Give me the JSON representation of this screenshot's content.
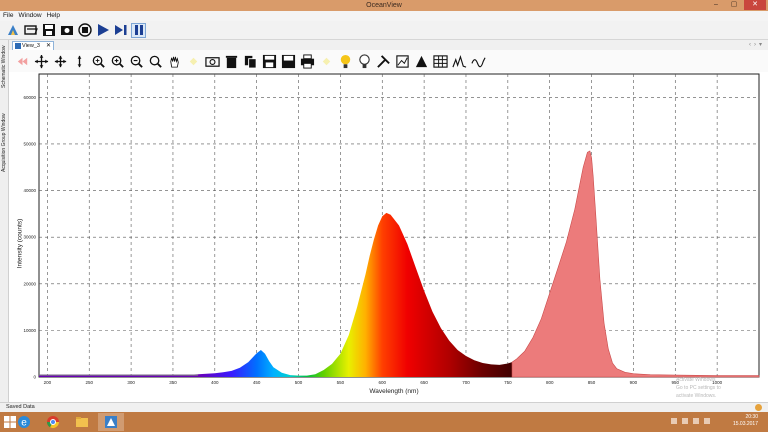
{
  "window": {
    "title": "OceanView",
    "minimize": "–",
    "maximize": "▢",
    "close": "✕"
  },
  "menu": [
    "File",
    "Window",
    "Help"
  ],
  "sidebar": {
    "tabs": [
      "Schematic Window",
      "Acquisition Group Window"
    ]
  },
  "view_tab": {
    "label": "View_3",
    "close": "✕"
  },
  "tab_nav": {
    "prev": "‹",
    "next": "›",
    "menu": "▾"
  },
  "main_toolbar": [
    "app-logo-icon",
    "open-icon",
    "save-icon",
    "camera-capture-icon",
    "device-icon",
    "play-icon",
    "step-icon",
    "pause-icon"
  ],
  "graph_toolbar": [
    "undo-icon",
    "move-icon",
    "move-xy-icon",
    "move-y-icon",
    "zoom-fit-icon",
    "zoom-in-icon",
    "zoom-out-icon",
    "zoom-reset-icon",
    "hand-icon",
    "spacer",
    "camera-icon",
    "trash-icon",
    "copy-icon",
    "save-graph-icon",
    "export-icon",
    "print-icon",
    "spacer",
    "lamp-on-icon",
    "lamp-off-icon",
    "tools-icon",
    "chart-icon",
    "peak-icon",
    "table-icon",
    "spectrum-icon",
    "overlay-icon"
  ],
  "chart_data": {
    "type": "area",
    "xlabel": "Wavelength (nm)",
    "ylabel": "Intensity (counts)",
    "xlim": [
      190,
      1050
    ],
    "ylim": [
      0,
      65000
    ],
    "x_ticks": [
      200,
      250,
      300,
      350,
      400,
      450,
      500,
      550,
      600,
      650,
      700,
      750,
      800,
      850,
      900,
      950,
      1000
    ],
    "y_ticks": [
      0,
      10000,
      20000,
      30000,
      40000,
      50000,
      60000
    ],
    "grid": true,
    "series": [
      {
        "fill": "spectrum-colors",
        "x": [
          190,
          350,
          370,
          380,
          390,
          400,
          410,
          420,
          430,
          440,
          450,
          455,
          460,
          465,
          470,
          480,
          490,
          500,
          510,
          520,
          530,
          540,
          550,
          560,
          570,
          575,
          580,
          585,
          590,
          595,
          600,
          605,
          610,
          620,
          630,
          640,
          650,
          660,
          670,
          680,
          690,
          700,
          710,
          720,
          730,
          740,
          750,
          755
        ],
        "y": [
          400,
          400,
          500,
          600,
          700,
          800,
          1000,
          1300,
          2000,
          3200,
          5100,
          5800,
          5000,
          3400,
          2100,
          900,
          400,
          300,
          300,
          600,
          1500,
          2800,
          5000,
          9000,
          15000,
          18500,
          22000,
          26000,
          29500,
          32500,
          34500,
          35200,
          34800,
          32500,
          28500,
          23500,
          18500,
          14000,
          10500,
          7800,
          5800,
          4500,
          3600,
          3000,
          2700,
          2600,
          2900,
          3200
        ]
      },
      {
        "fill": "#ec7b7b",
        "x": [
          755,
          760,
          770,
          780,
          790,
          800,
          810,
          820,
          830,
          835,
          840,
          845,
          848,
          850,
          852,
          855,
          860,
          865,
          870,
          875,
          880,
          890,
          900,
          920,
          950,
          1000,
          1050
        ],
        "y": [
          3200,
          3800,
          5500,
          8500,
          12500,
          18000,
          23500,
          29000,
          36000,
          40500,
          45000,
          48200,
          48500,
          47000,
          43000,
          35000,
          21000,
          11500,
          6000,
          3000,
          1800,
          1000,
          700,
          500,
          400,
          300,
          300
        ]
      }
    ]
  },
  "status": {
    "text": "Saved Data"
  },
  "taskbar": {
    "apps": [
      "ie-icon",
      "chrome-icon",
      "explorer-icon",
      "oceanview-icon"
    ],
    "time": "20:30",
    "date": "15.03.2017"
  },
  "watermark": {
    "line1": "Activate Windows",
    "line2": "Go to PC settings to activate Windows."
  }
}
